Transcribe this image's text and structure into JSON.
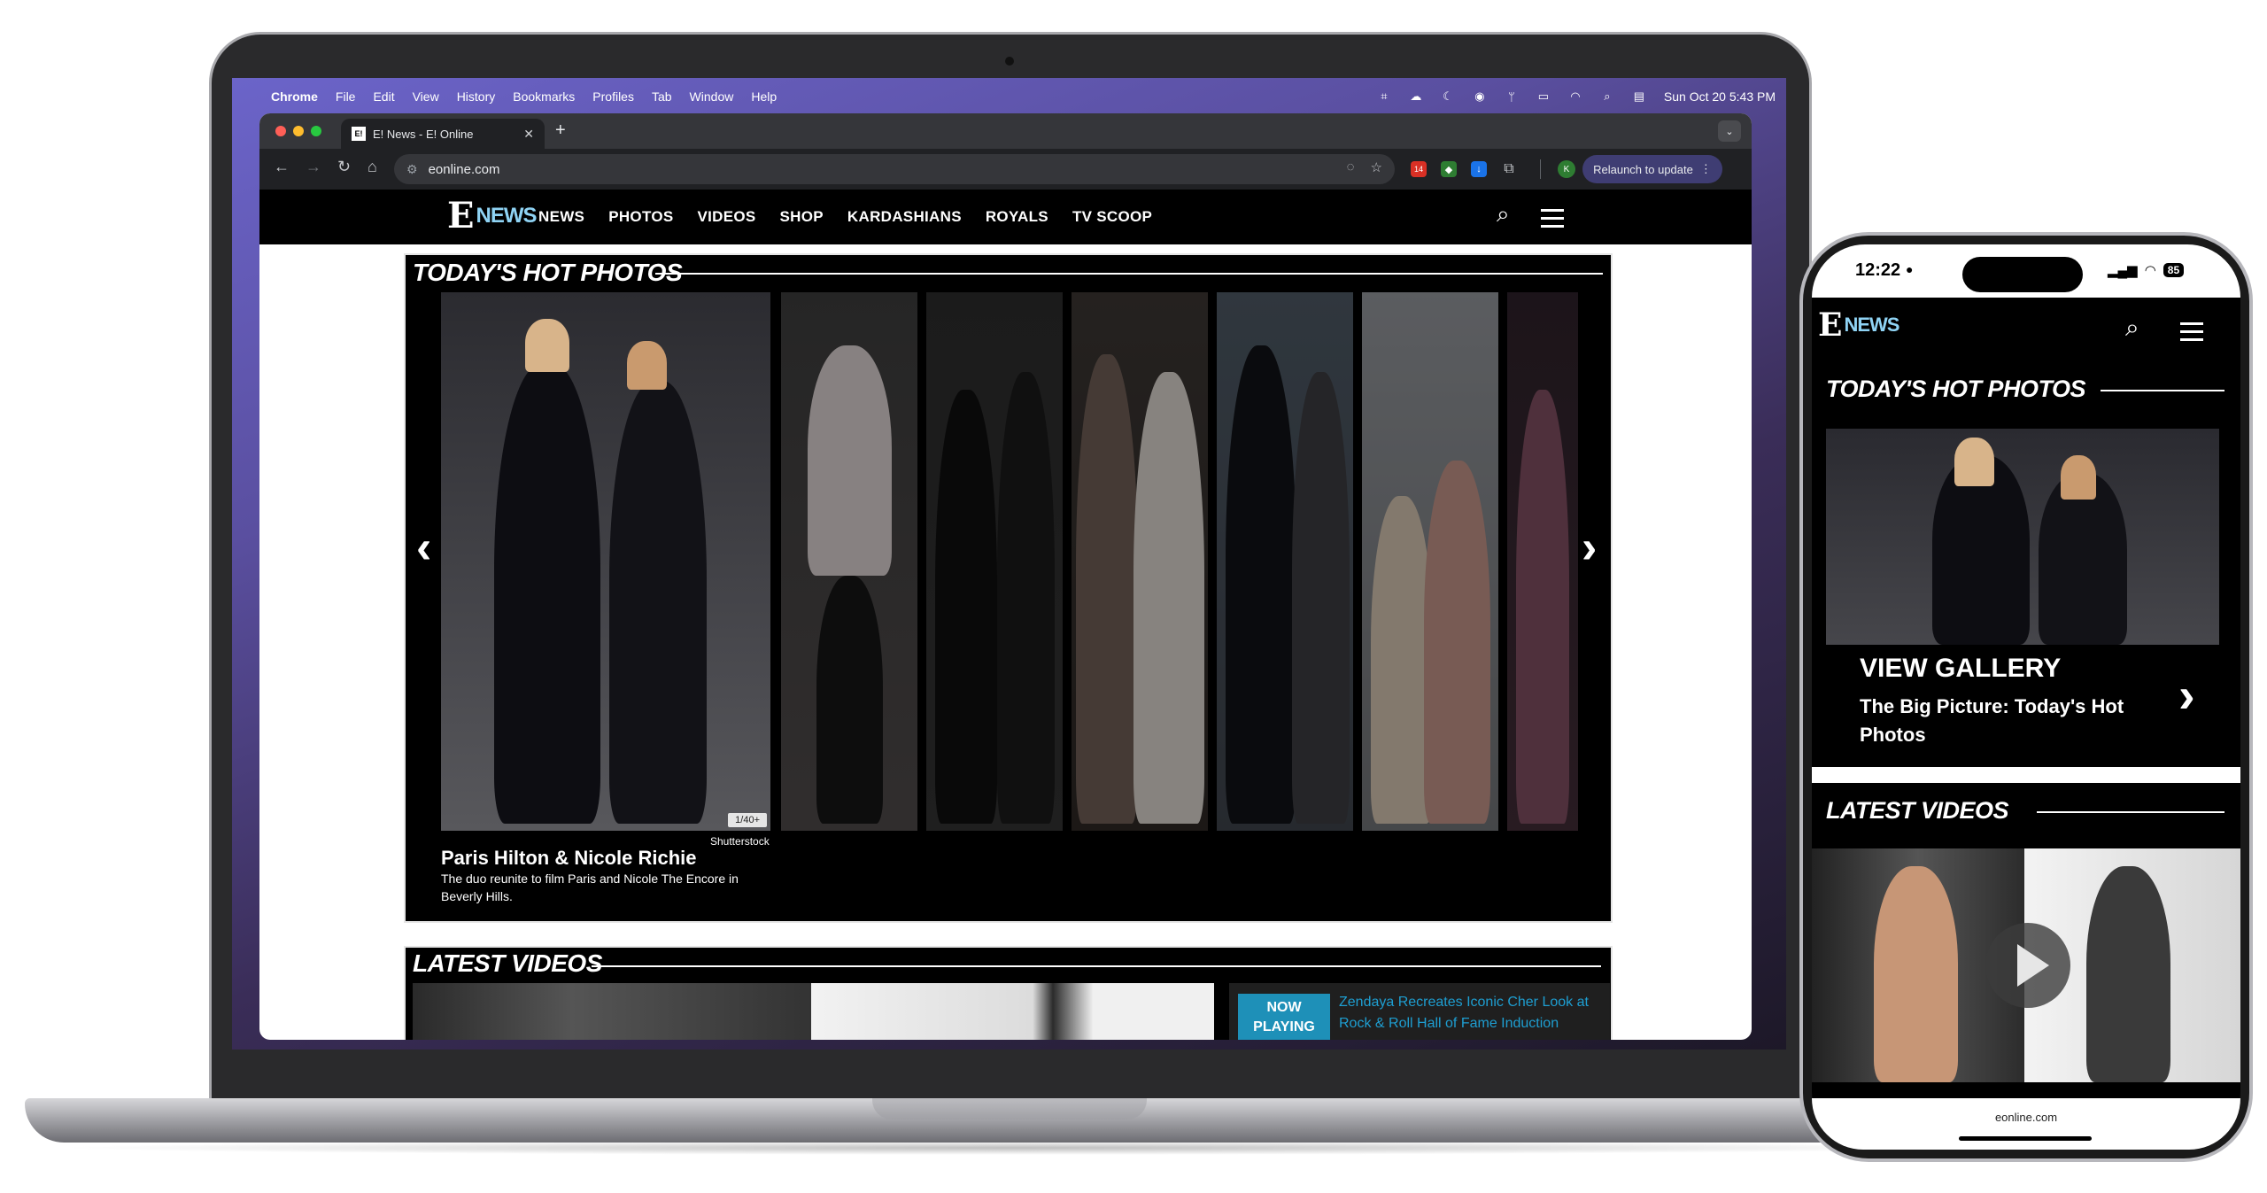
{
  "menubar": {
    "app": "Chrome",
    "items": [
      "File",
      "Edit",
      "View",
      "History",
      "Bookmarks",
      "Profiles",
      "Tab",
      "Window",
      "Help"
    ],
    "datetime": "Sun Oct 20  5:43 PM",
    "icons": [
      "apple-icon",
      "grid-icon",
      "cloud-icon",
      "moon-icon",
      "play-circle-icon",
      "antenna-icon",
      "battery-icon",
      "wifi-icon",
      "search-icon",
      "control-center-icon"
    ]
  },
  "browser": {
    "tab_title": "E! News - E! Online",
    "favicon_text": "E!",
    "url": "eonline.com",
    "relaunch_label": "Relaunch to update",
    "profile_initial": "K",
    "extension_badge": "14"
  },
  "site": {
    "logo_e": "E",
    "logo_news": "NEWS",
    "nav": [
      "NEWS",
      "PHOTOS",
      "VIDEOS",
      "SHOP",
      "KARDASHIANS",
      "ROYALS",
      "TV SCOOP"
    ]
  },
  "hot_photos": {
    "title": "TODAY'S HOT PHOTOS",
    "counter": "1/40+",
    "credit": "Shutterstock",
    "caption_title": "Paris Hilton & Nicole Richie",
    "caption_text": "The duo reunite to film Paris and Nicole The Encore in Beverly Hills.",
    "prev_arrow": "‹",
    "next_arrow": "›"
  },
  "latest_videos": {
    "title": "LATEST VIDEOS",
    "now_playing": "NOW PLAYING",
    "now_playing_title": "Zendaya Recreates Iconic Cher Look at Rock & Roll Hall of Fame Induction"
  },
  "phone": {
    "time": "12:22",
    "battery": "85",
    "hot_photos_title": "TODAY'S HOT PHOTOS",
    "view_gallery": "VIEW GALLERY",
    "gallery_subtitle": "The Big Picture: Today's Hot Photos",
    "latest_videos_title": "LATEST VIDEOS",
    "url": "eonline.com"
  },
  "colors": {
    "accent_news": "#8fd3f4",
    "now_playing_bg": "#1e90b8",
    "relaunch_bg": "#3f3d73"
  }
}
